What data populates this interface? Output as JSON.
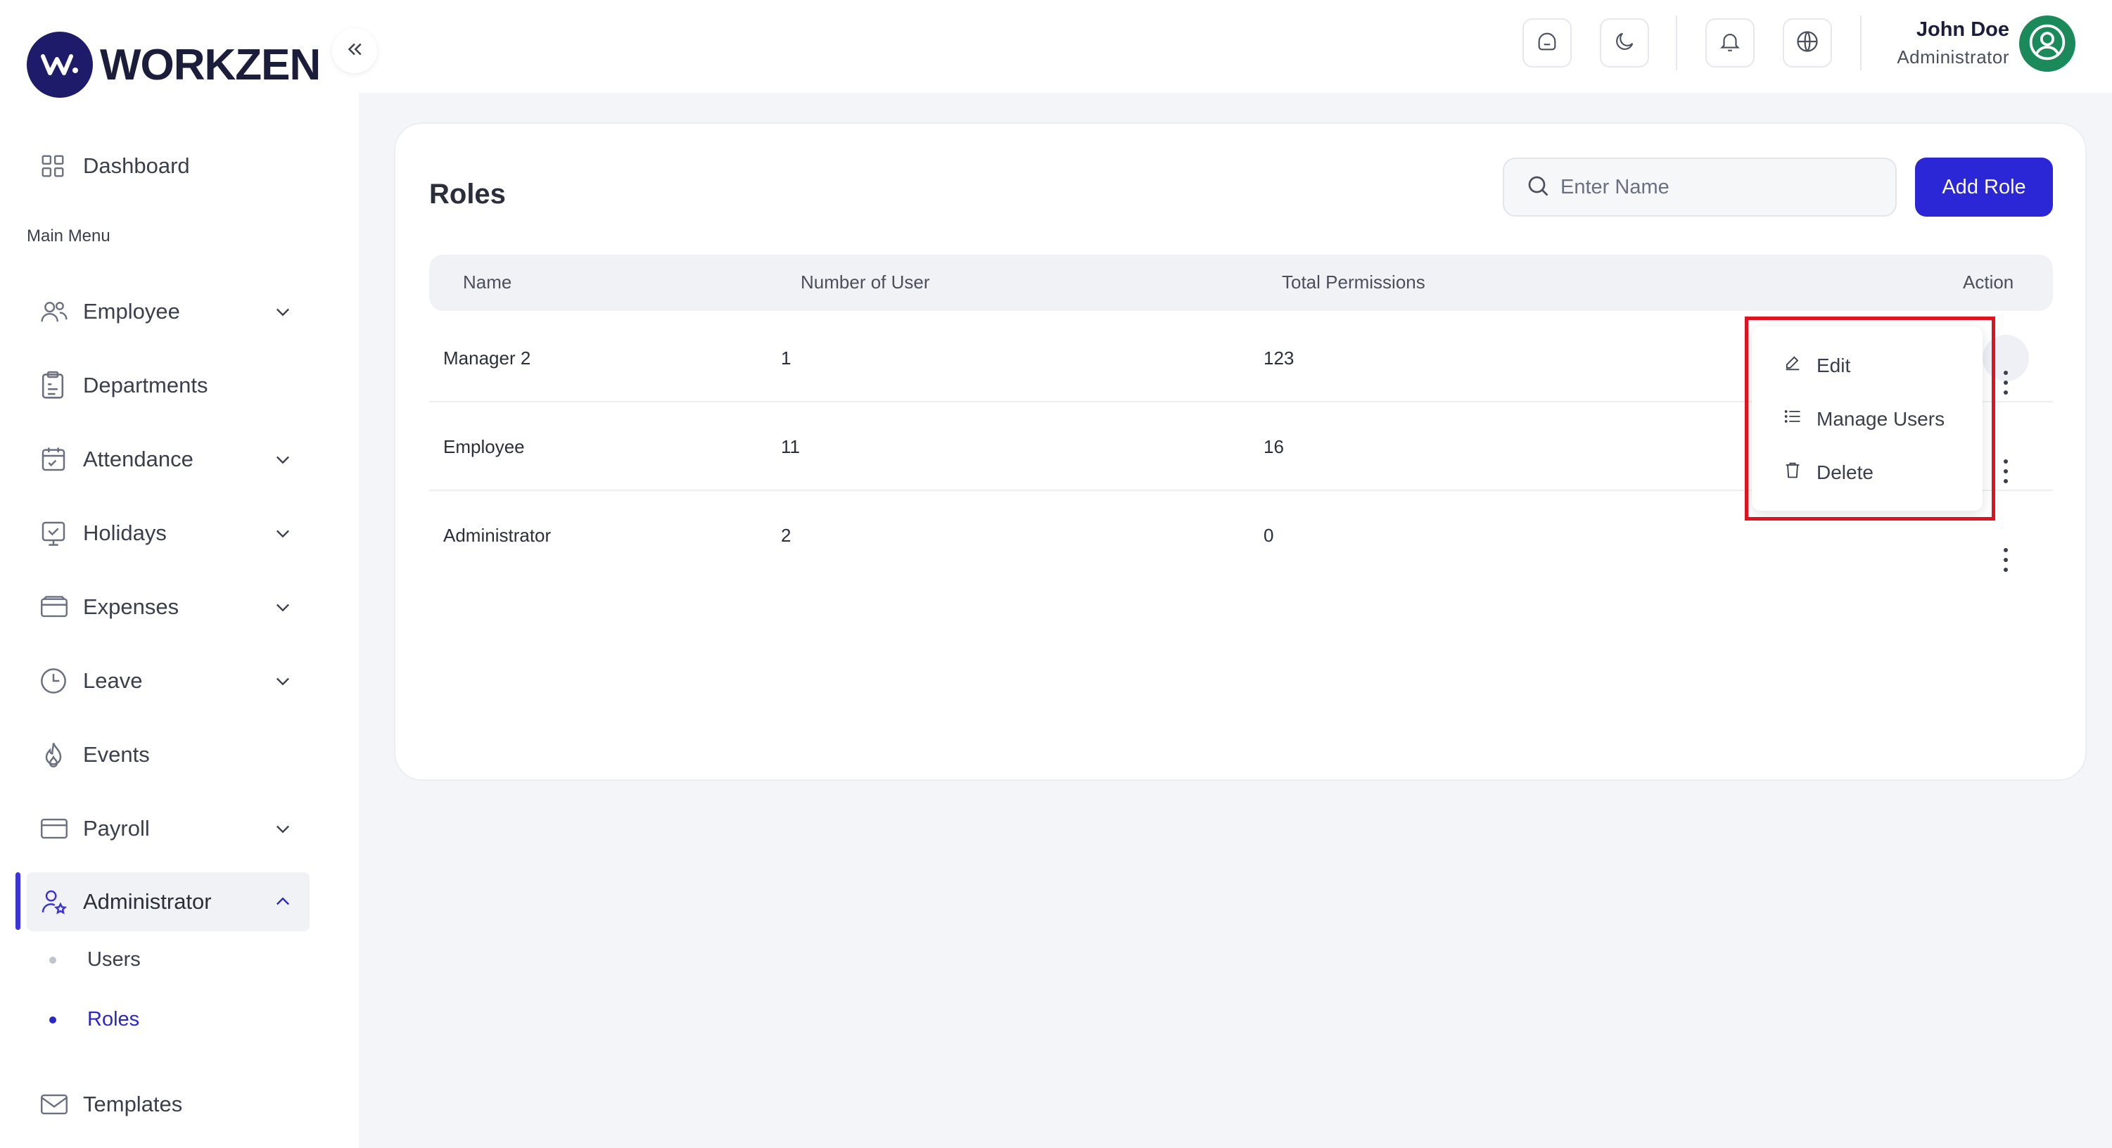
{
  "brand": {
    "name": "WORKZEN",
    "accent": "#2b26d6"
  },
  "sidebar": {
    "dashboard": "Dashboard",
    "section_label": "Main Menu",
    "items": [
      {
        "label": "Employee",
        "icon": "users-icon",
        "expandable": true
      },
      {
        "label": "Departments",
        "icon": "clipboard-icon",
        "expandable": false
      },
      {
        "label": "Attendance",
        "icon": "calendar-icon",
        "expandable": true
      },
      {
        "label": "Holidays",
        "icon": "monitor-check-icon",
        "expandable": true
      },
      {
        "label": "Expenses",
        "icon": "wallet-icon",
        "expandable": true
      },
      {
        "label": "Leave",
        "icon": "clock-icon",
        "expandable": true
      },
      {
        "label": "Events",
        "icon": "flame-icon",
        "expandable": false
      },
      {
        "label": "Payroll",
        "icon": "card-icon",
        "expandable": true
      },
      {
        "label": "Administrator",
        "icon": "user-star-icon",
        "expandable": true,
        "active": true
      }
    ],
    "sub_items": [
      {
        "label": "Users",
        "active": false
      },
      {
        "label": "Roles",
        "active": true
      }
    ],
    "templates": "Templates"
  },
  "header": {
    "user_name": "John Doe",
    "user_role": "Administrator"
  },
  "page": {
    "title": "Roles",
    "search_placeholder": "Enter Name",
    "add_button": "Add Role"
  },
  "table": {
    "columns": [
      "Name",
      "Number of User",
      "Total Permissions",
      "Action"
    ],
    "rows": [
      {
        "name": "Manager 2",
        "users": "1",
        "permissions": "123"
      },
      {
        "name": "Employee",
        "users": "11",
        "permissions": "16"
      },
      {
        "name": "Administrator",
        "users": "2",
        "permissions": "0"
      }
    ]
  },
  "dropdown": {
    "items": [
      "Edit",
      "Manage Users",
      "Delete"
    ]
  }
}
